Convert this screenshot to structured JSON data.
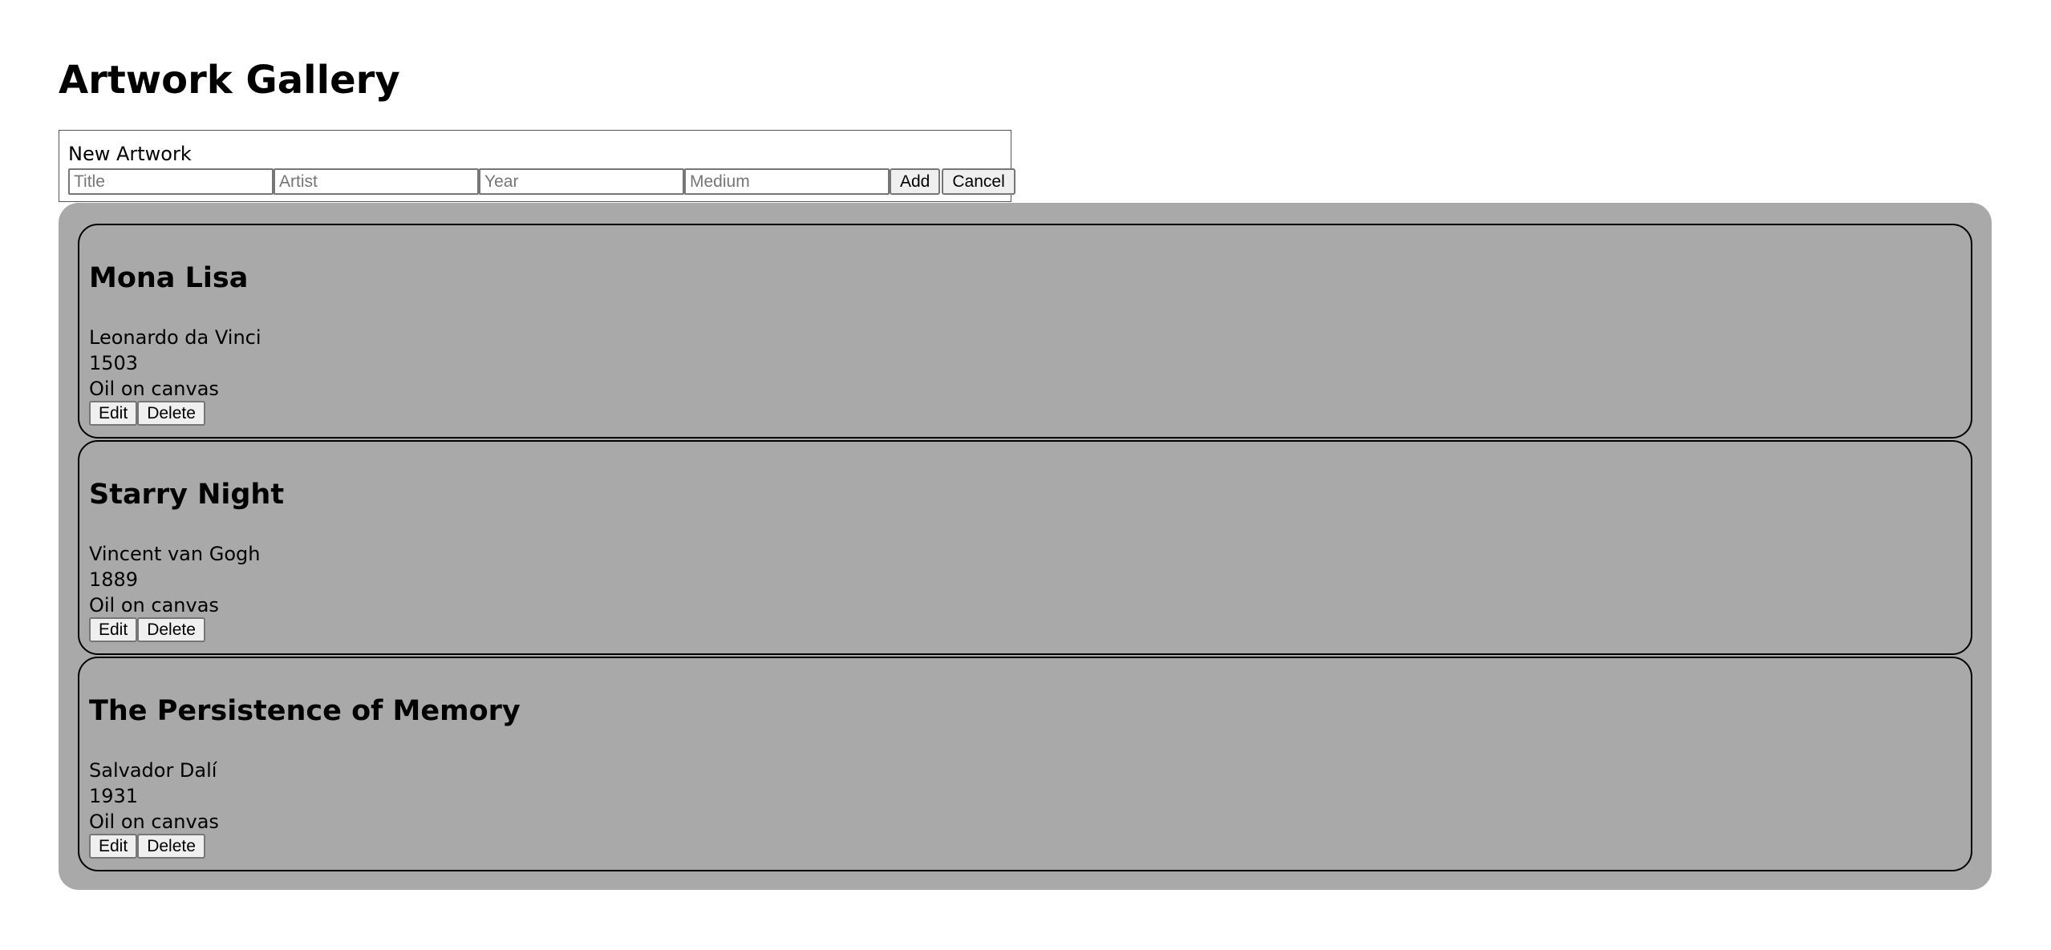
{
  "page": {
    "title": "Artwork Gallery"
  },
  "form": {
    "legend": "New Artwork",
    "fields": {
      "title": {
        "placeholder": "Title",
        "value": ""
      },
      "artist": {
        "placeholder": "Artist",
        "value": ""
      },
      "year": {
        "placeholder": "Year",
        "value": ""
      },
      "medium": {
        "placeholder": "Medium",
        "value": ""
      }
    },
    "add_label": "Add",
    "cancel_label": "Cancel"
  },
  "artworks": [
    {
      "title": "Mona Lisa",
      "artist": "Leonardo da Vinci",
      "year": "1503",
      "medium": "Oil on canvas",
      "edit_label": "Edit",
      "delete_label": "Delete"
    },
    {
      "title": "Starry Night",
      "artist": "Vincent van Gogh",
      "year": "1889",
      "medium": "Oil on canvas",
      "edit_label": "Edit",
      "delete_label": "Delete"
    },
    {
      "title": "The Persistence of Memory",
      "artist": "Salvador Dalí",
      "year": "1931",
      "medium": "Oil on canvas",
      "edit_label": "Edit",
      "delete_label": "Delete"
    }
  ],
  "colors": {
    "gallery_background": "#a9a9a9",
    "card_border": "#000000",
    "form_border": "#555555",
    "button_background": "#efefef"
  }
}
